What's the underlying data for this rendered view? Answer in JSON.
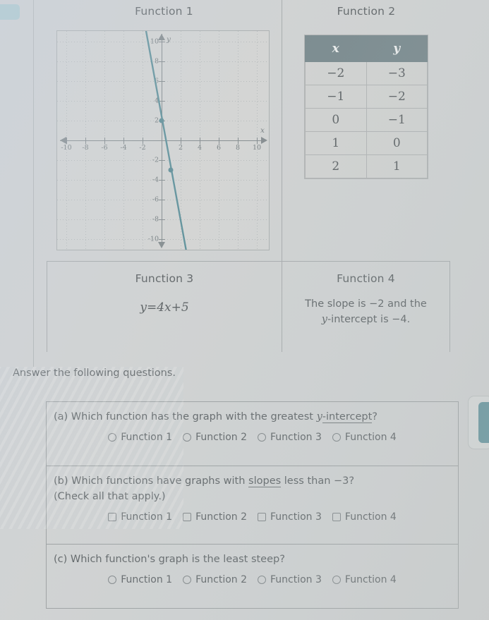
{
  "functions": {
    "f1": {
      "title": "Function 1"
    },
    "f2": {
      "title": "Function 2",
      "columns": [
        "x",
        "y"
      ],
      "rows": [
        [
          "−2",
          "−3"
        ],
        [
          "−1",
          "−2"
        ],
        [
          "0",
          "−1"
        ],
        [
          "1",
          "0"
        ],
        [
          "2",
          "1"
        ]
      ]
    },
    "f3": {
      "title": "Function 3",
      "equation": "y=4x+5"
    },
    "f4": {
      "title": "Function 4",
      "line1": "The slope is −2 and the",
      "line2_pre": "y",
      "line2_post": "-intercept is −4."
    }
  },
  "answer_section": {
    "heading": "Answer the following questions.",
    "questions": [
      {
        "id": "a",
        "prompt_pre": "(a) Which function has the graph with the greatest ",
        "prompt_italic": "y",
        "prompt_underlined": "-intercept",
        "prompt_post": "?",
        "input_type": "radio",
        "options": [
          "Function 1",
          "Function 2",
          "Function 3",
          "Function 4"
        ]
      },
      {
        "id": "b",
        "prompt_pre": "(b) Which functions have graphs with ",
        "prompt_underlined": "slopes",
        "prompt_post": " less than −3?",
        "prompt_line2": "(Check all that apply.)",
        "input_type": "checkbox",
        "options": [
          "Function 1",
          "Function 2",
          "Function 3",
          "Function 4"
        ]
      },
      {
        "id": "c",
        "prompt_pre": "(c) Which function's graph is the least steep?",
        "input_type": "radio",
        "options": [
          "Function 1",
          "Function 2",
          "Function 3",
          "Function 4"
        ]
      }
    ]
  },
  "chart_data": {
    "type": "line",
    "title": "Function 1",
    "xlabel": "x",
    "ylabel": "y",
    "xlim": [
      -11,
      11
    ],
    "ylim": [
      -11,
      11
    ],
    "xticks": [
      -10,
      -8,
      -6,
      -4,
      -2,
      2,
      4,
      6,
      8,
      10
    ],
    "yticks": [
      10,
      8,
      6,
      4,
      2,
      -2,
      -4,
      -6,
      -8,
      -10
    ],
    "grid": true,
    "legend": "none",
    "line_color": "#417c88",
    "slope": -5,
    "intercept": 2,
    "equation": "y = -5x + 2",
    "marked_points": [
      [
        0,
        2
      ],
      [
        1,
        -3
      ]
    ],
    "series": [
      {
        "name": "Function 1",
        "x": [
          -1.6,
          2.6
        ],
        "y": [
          10,
          -11
        ]
      }
    ]
  },
  "colors": {
    "accent_teal": "#3f7f8c",
    "table_header": "#5f747a",
    "page_background": "#cfd2d3",
    "text": "#3f464a",
    "border": "#9aa0a2"
  }
}
